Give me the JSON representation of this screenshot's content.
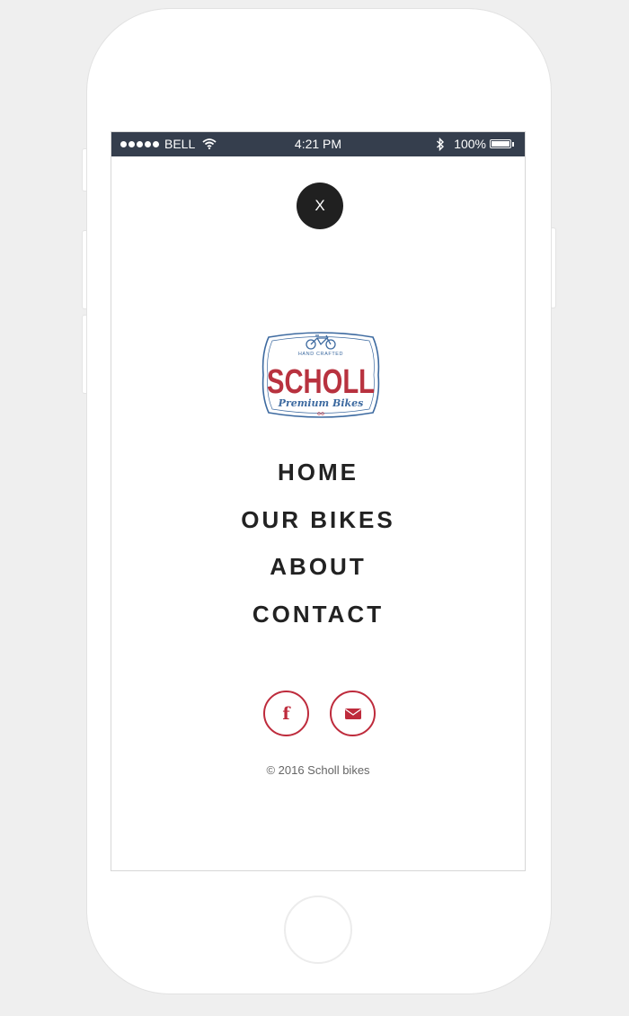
{
  "status_bar": {
    "carrier": "BELL",
    "time": "4:21 PM",
    "battery_percent_label": "100%",
    "battery_level": 1.0,
    "background_color": "#353e4d",
    "icons": [
      "signal-dots-icon",
      "wifi-icon",
      "bluetooth-icon",
      "battery-icon"
    ]
  },
  "menu": {
    "close_label": "X",
    "items": [
      {
        "label": "HOME"
      },
      {
        "label": "OUR BIKES"
      },
      {
        "label": "ABOUT"
      },
      {
        "label": "CONTACT"
      }
    ]
  },
  "logo": {
    "tagline": "HAND CRAFTED",
    "brand": "SCHOLL",
    "subtitle": "Premium Bikes",
    "icon": "bicycle-icon"
  },
  "social": {
    "items": [
      "facebook-icon",
      "email-icon"
    ],
    "accent_color": "#be2b3c"
  },
  "footer": {
    "copyright": "© 2016 Scholl bikes"
  }
}
